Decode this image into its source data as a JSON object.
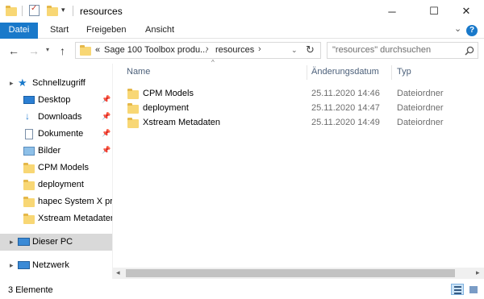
{
  "window": {
    "title": "resources",
    "controls": {
      "minimize": "─",
      "maximize": "☐",
      "close": "✕"
    }
  },
  "ribbon": {
    "tabs": [
      "Datei",
      "Start",
      "Freigeben",
      "Ansicht"
    ],
    "expand_glyph": "⌄",
    "help_glyph": "?"
  },
  "addressbar": {
    "overflow": "«",
    "crumbs": [
      "Sage 100 Toolbox produ...",
      "resources"
    ],
    "search_placeholder": "\"resources\" durchsuchen"
  },
  "nav": {
    "quick_access": "Schnellzugriff",
    "items": [
      {
        "label": "Desktop",
        "icon": "desktop-icon",
        "pinned": true
      },
      {
        "label": "Downloads",
        "icon": "downloads-icon",
        "pinned": true
      },
      {
        "label": "Dokumente",
        "icon": "documents-icon",
        "pinned": true
      },
      {
        "label": "Bilder",
        "icon": "pictures-icon",
        "pinned": true
      },
      {
        "label": "CPM Models",
        "icon": "folder-icon",
        "pinned": false
      },
      {
        "label": "deployment",
        "icon": "folder-icon",
        "pinned": false
      },
      {
        "label": "hapec System X pro",
        "icon": "folder-icon",
        "pinned": false
      },
      {
        "label": "Xstream Metadaten",
        "icon": "folder-icon",
        "pinned": false
      }
    ],
    "this_pc": "Dieser PC",
    "network": "Netzwerk"
  },
  "filelist": {
    "columns": {
      "name": "Name",
      "date": "Änderungsdatum",
      "type": "Typ"
    },
    "rows": [
      {
        "name": "CPM Models",
        "date": "25.11.2020 14:46",
        "type": "Dateiordner"
      },
      {
        "name": "deployment",
        "date": "25.11.2020 14:47",
        "type": "Dateiordner"
      },
      {
        "name": "Xstream Metadaten",
        "date": "25.11.2020 14:49",
        "type": "Dateiordner"
      }
    ]
  },
  "status": {
    "item_count": "3 Elemente"
  },
  "colors": {
    "accent": "#1979ca",
    "folder": "#f8d775",
    "selected": "#d9d9d9"
  }
}
